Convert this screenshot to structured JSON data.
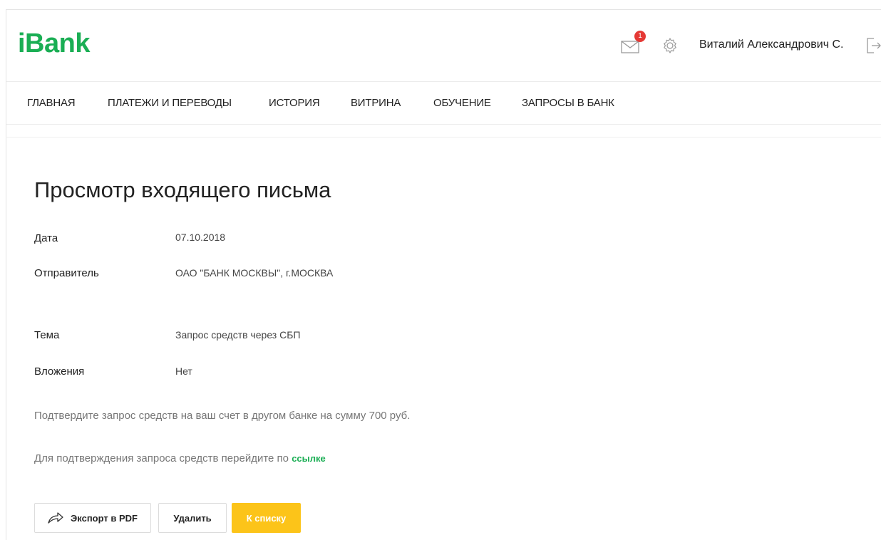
{
  "header": {
    "logo": "iBank",
    "mail_badge": "1",
    "user_name": "Виталий Александрович С.",
    "colors": {
      "brand": "#1aae54",
      "badge": "#e53935",
      "primary_button": "#fcc419"
    }
  },
  "nav": {
    "items": [
      "Главная",
      "Платежи и переводы",
      "История",
      "Витрина",
      "Обучение",
      "Запросы в банк"
    ]
  },
  "page": {
    "title": "Просмотр входящего письма"
  },
  "letter": {
    "date_label": "Дата",
    "date_value": "07.10.2018",
    "sender_label": "Отправитель",
    "sender_value": "ОАО \"БАНК МОСКВЫ\", г.МОСКВА",
    "subject_label": "Тема",
    "subject_value": "Запрос средств через СБП",
    "attachments_label": "Вложения",
    "attachments_value": "Нет",
    "body_line1": "Подтвердите запрос средств на ваш счет в другом банке на сумму 700 руб.",
    "body_line2_text": "Для подтверждения запроса средств перейдите по",
    "body_line2_link": "ссылке"
  },
  "actions": {
    "export_label": "Экспорт в PDF",
    "delete_label": "Удалить",
    "to_list_label": "К списку"
  },
  "icons": [
    "mail-icon",
    "gear-icon",
    "logout-icon",
    "share-icon"
  ]
}
